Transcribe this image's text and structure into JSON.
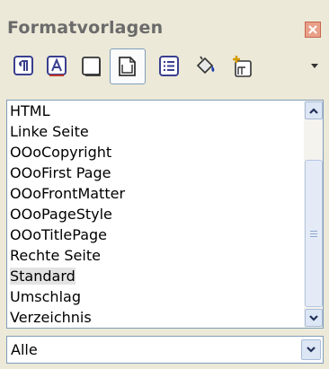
{
  "window": {
    "title": "Formatvorlagen",
    "close_icon": "close-icon"
  },
  "toolbar": {
    "buttons": [
      {
        "name": "paragraph-styles",
        "icon": "paragraph-style-icon"
      },
      {
        "name": "character-styles",
        "icon": "character-style-icon"
      },
      {
        "name": "frame-styles",
        "icon": "frame-style-icon"
      },
      {
        "name": "page-styles",
        "icon": "page-style-icon",
        "active": true
      },
      {
        "name": "list-styles",
        "icon": "list-style-icon"
      },
      {
        "name": "fill-format-mode",
        "icon": "paint-bucket-icon"
      },
      {
        "name": "new-style-from-selection",
        "icon": "new-style-icon"
      },
      {
        "name": "more-options",
        "icon": "chevron-down-icon"
      }
    ]
  },
  "styles_list": {
    "items": [
      "HTML",
      "Linke Seite",
      "OOoCopyright",
      "OOoFirst Page",
      "OOoFrontMatter",
      "OOoPageStyle",
      "OOoTitlePage",
      "Rechte Seite",
      "Standard",
      "Umschlag",
      "Verzeichnis"
    ],
    "selected": "Standard"
  },
  "filter": {
    "value": "Alle"
  }
}
